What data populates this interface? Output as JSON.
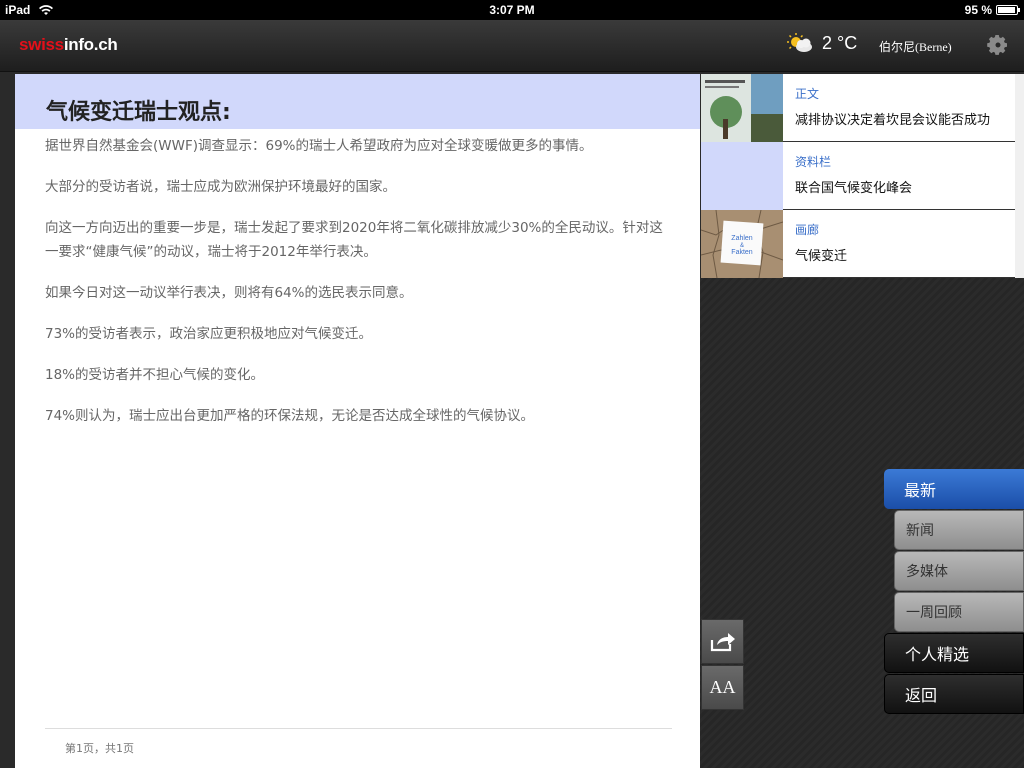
{
  "status_bar": {
    "device": "iPad",
    "time": "3:07 PM",
    "battery": "95 %"
  },
  "header": {
    "logo_red": "swiss",
    "logo_white": "info.ch",
    "temperature": "2 °C",
    "city": "伯尔尼(Berne)",
    "weather_icon": "partly-cloudy-icon",
    "settings_icon": "gear-icon"
  },
  "article": {
    "title": "气候变迁瑞士观点:",
    "paragraphs": [
      "据世界自然基金会(WWF)调查显示：69%的瑞士人希望政府为应对全球变暖做更多的事情。",
      "大部分的受访者说，瑞士应成为欧洲保护环境最好的国家。",
      "向这一方向迈出的重要一步是，瑞士发起了要求到2020年将二氧化碳排放减少30%的全民动议。针对这一要求“健康气候”的动议，瑞士将于2012年举行表决。",
      "如果今日对这一动议举行表决，则将有64%的选民表示同意。",
      "73%的受访者表示，政治家应更积极地应对气候变迁。",
      "18%的受访者并不担心气候的变化。",
      "74%则认为，瑞士应出台更加严格的环保法规，无论是否达成全球性的气候协议。"
    ],
    "page_info": "第1页，共1页"
  },
  "related": [
    {
      "category": "正文",
      "headline": "减排协议决定着坎昆会议能否成功"
    },
    {
      "category": "资料栏",
      "headline": "联合国气候变化峰会"
    },
    {
      "category": "画廊",
      "headline": "气候变迁",
      "thumb_text_1": "Zahlen",
      "thumb_text_2": "&",
      "thumb_text_3": "Fakten"
    }
  ],
  "tools": {
    "share_icon": "share-icon",
    "font_label": "AA"
  },
  "nav": {
    "latest": "最新",
    "news": "新闻",
    "multimedia": "多媒体",
    "weekly": "一周回顾",
    "personal": "个人精选",
    "back": "返回"
  },
  "colors": {
    "brand_red": "#e3101a",
    "title_bar": "#d1d8fb",
    "link_blue": "#3a6fc9",
    "nav_active": "#1b4ea8"
  }
}
